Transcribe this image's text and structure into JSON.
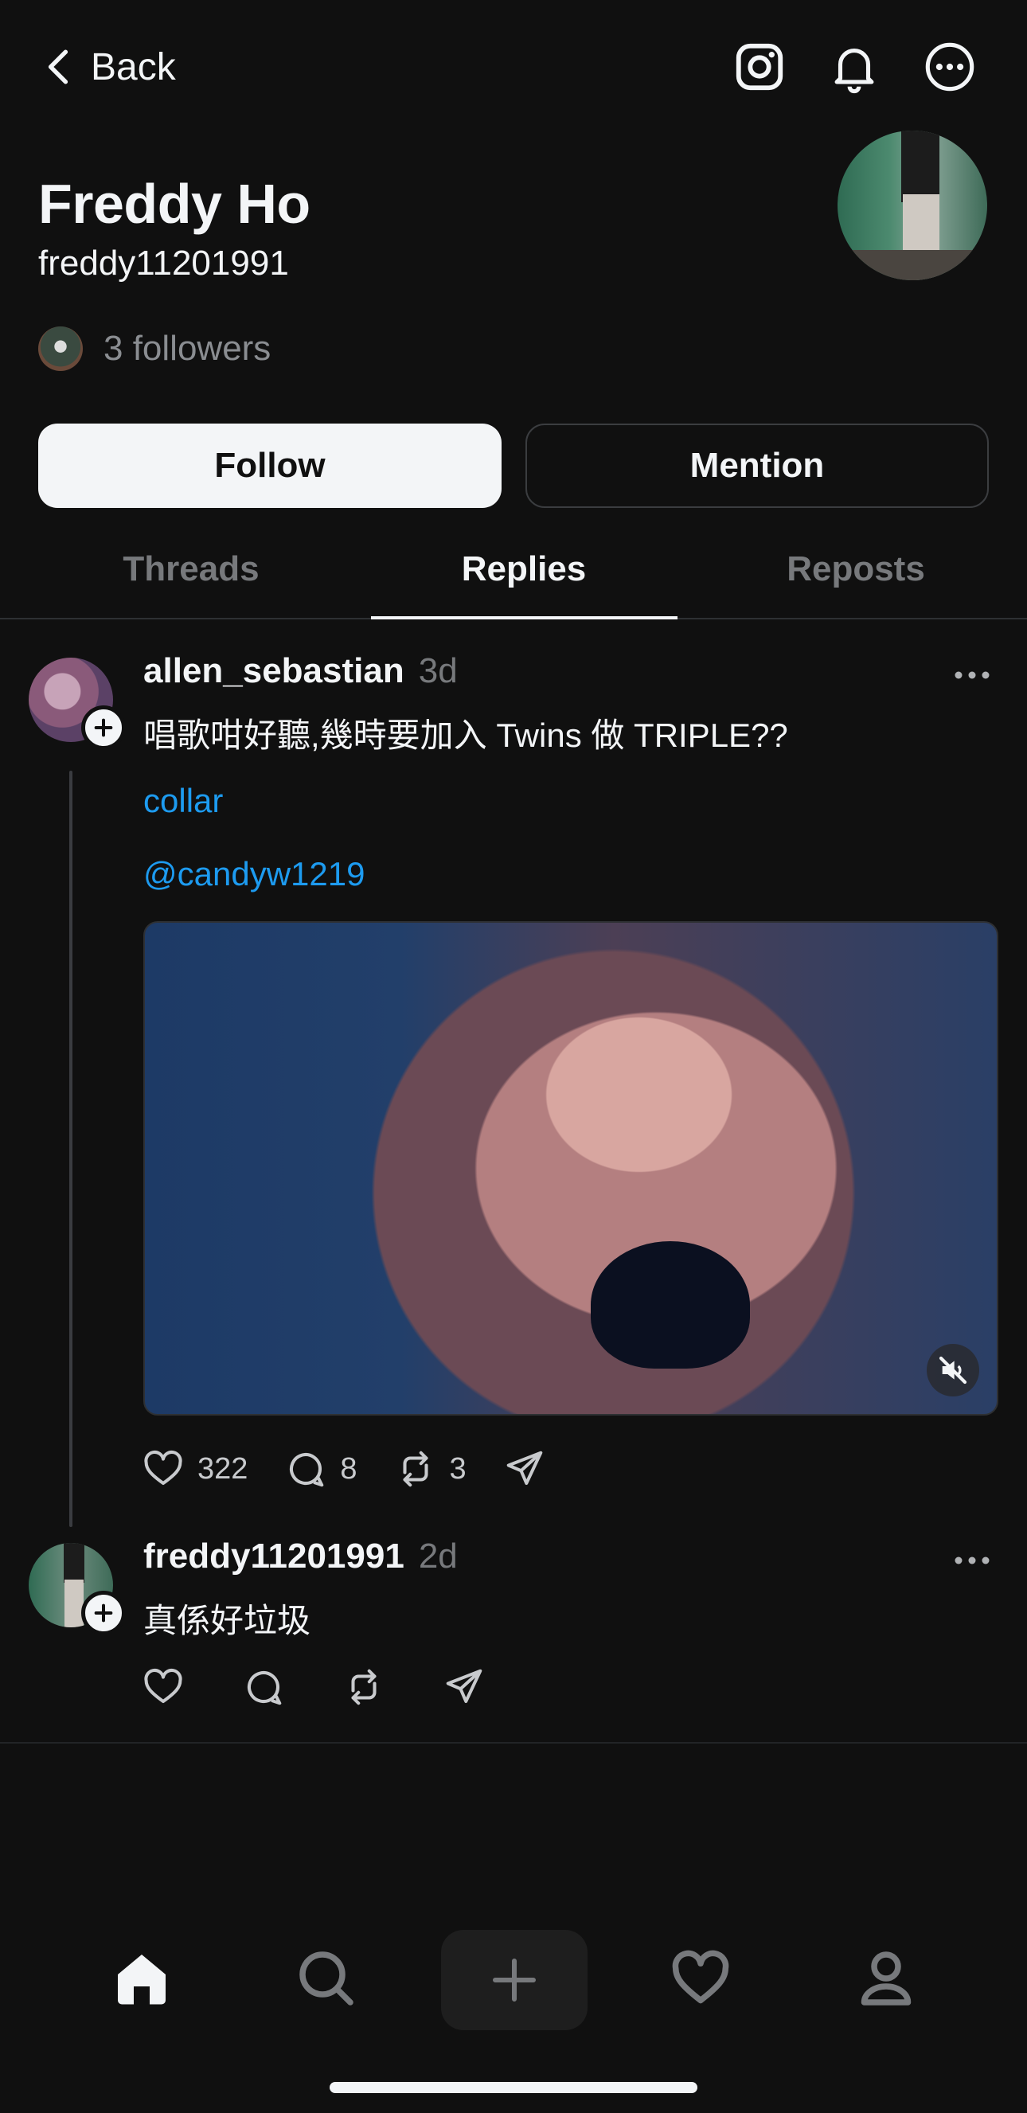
{
  "header": {
    "back_label": "Back",
    "icons": [
      "instagram-icon",
      "bell-icon",
      "more-options-icon"
    ]
  },
  "profile": {
    "name": "Freddy Ho",
    "handle": "freddy11201991",
    "followers_text": "3 followers",
    "follow_label": "Follow",
    "mention_label": "Mention"
  },
  "tabs": [
    {
      "label": "Threads",
      "active": false
    },
    {
      "label": "Replies",
      "active": true
    },
    {
      "label": "Reposts",
      "active": false
    }
  ],
  "posts": [
    {
      "username": "allen_sebastian",
      "time": "3d",
      "text": "唱歌咁好聽,幾時要加入 Twins 做 TRIPLE??",
      "tag": "collar",
      "mention": "@candyw1219",
      "likes": "322",
      "comments": "8",
      "reposts": "3"
    },
    {
      "username": "freddy11201991",
      "time": "2d",
      "text": "真係好垃圾"
    }
  ],
  "colors": {
    "background": "#101010",
    "text": "#f3f5f7",
    "muted": "#77797c",
    "link": "#1d9bf0"
  },
  "bottom_nav": [
    "home-icon",
    "search-icon",
    "create-plus-icon",
    "heart-icon",
    "profile-icon"
  ]
}
